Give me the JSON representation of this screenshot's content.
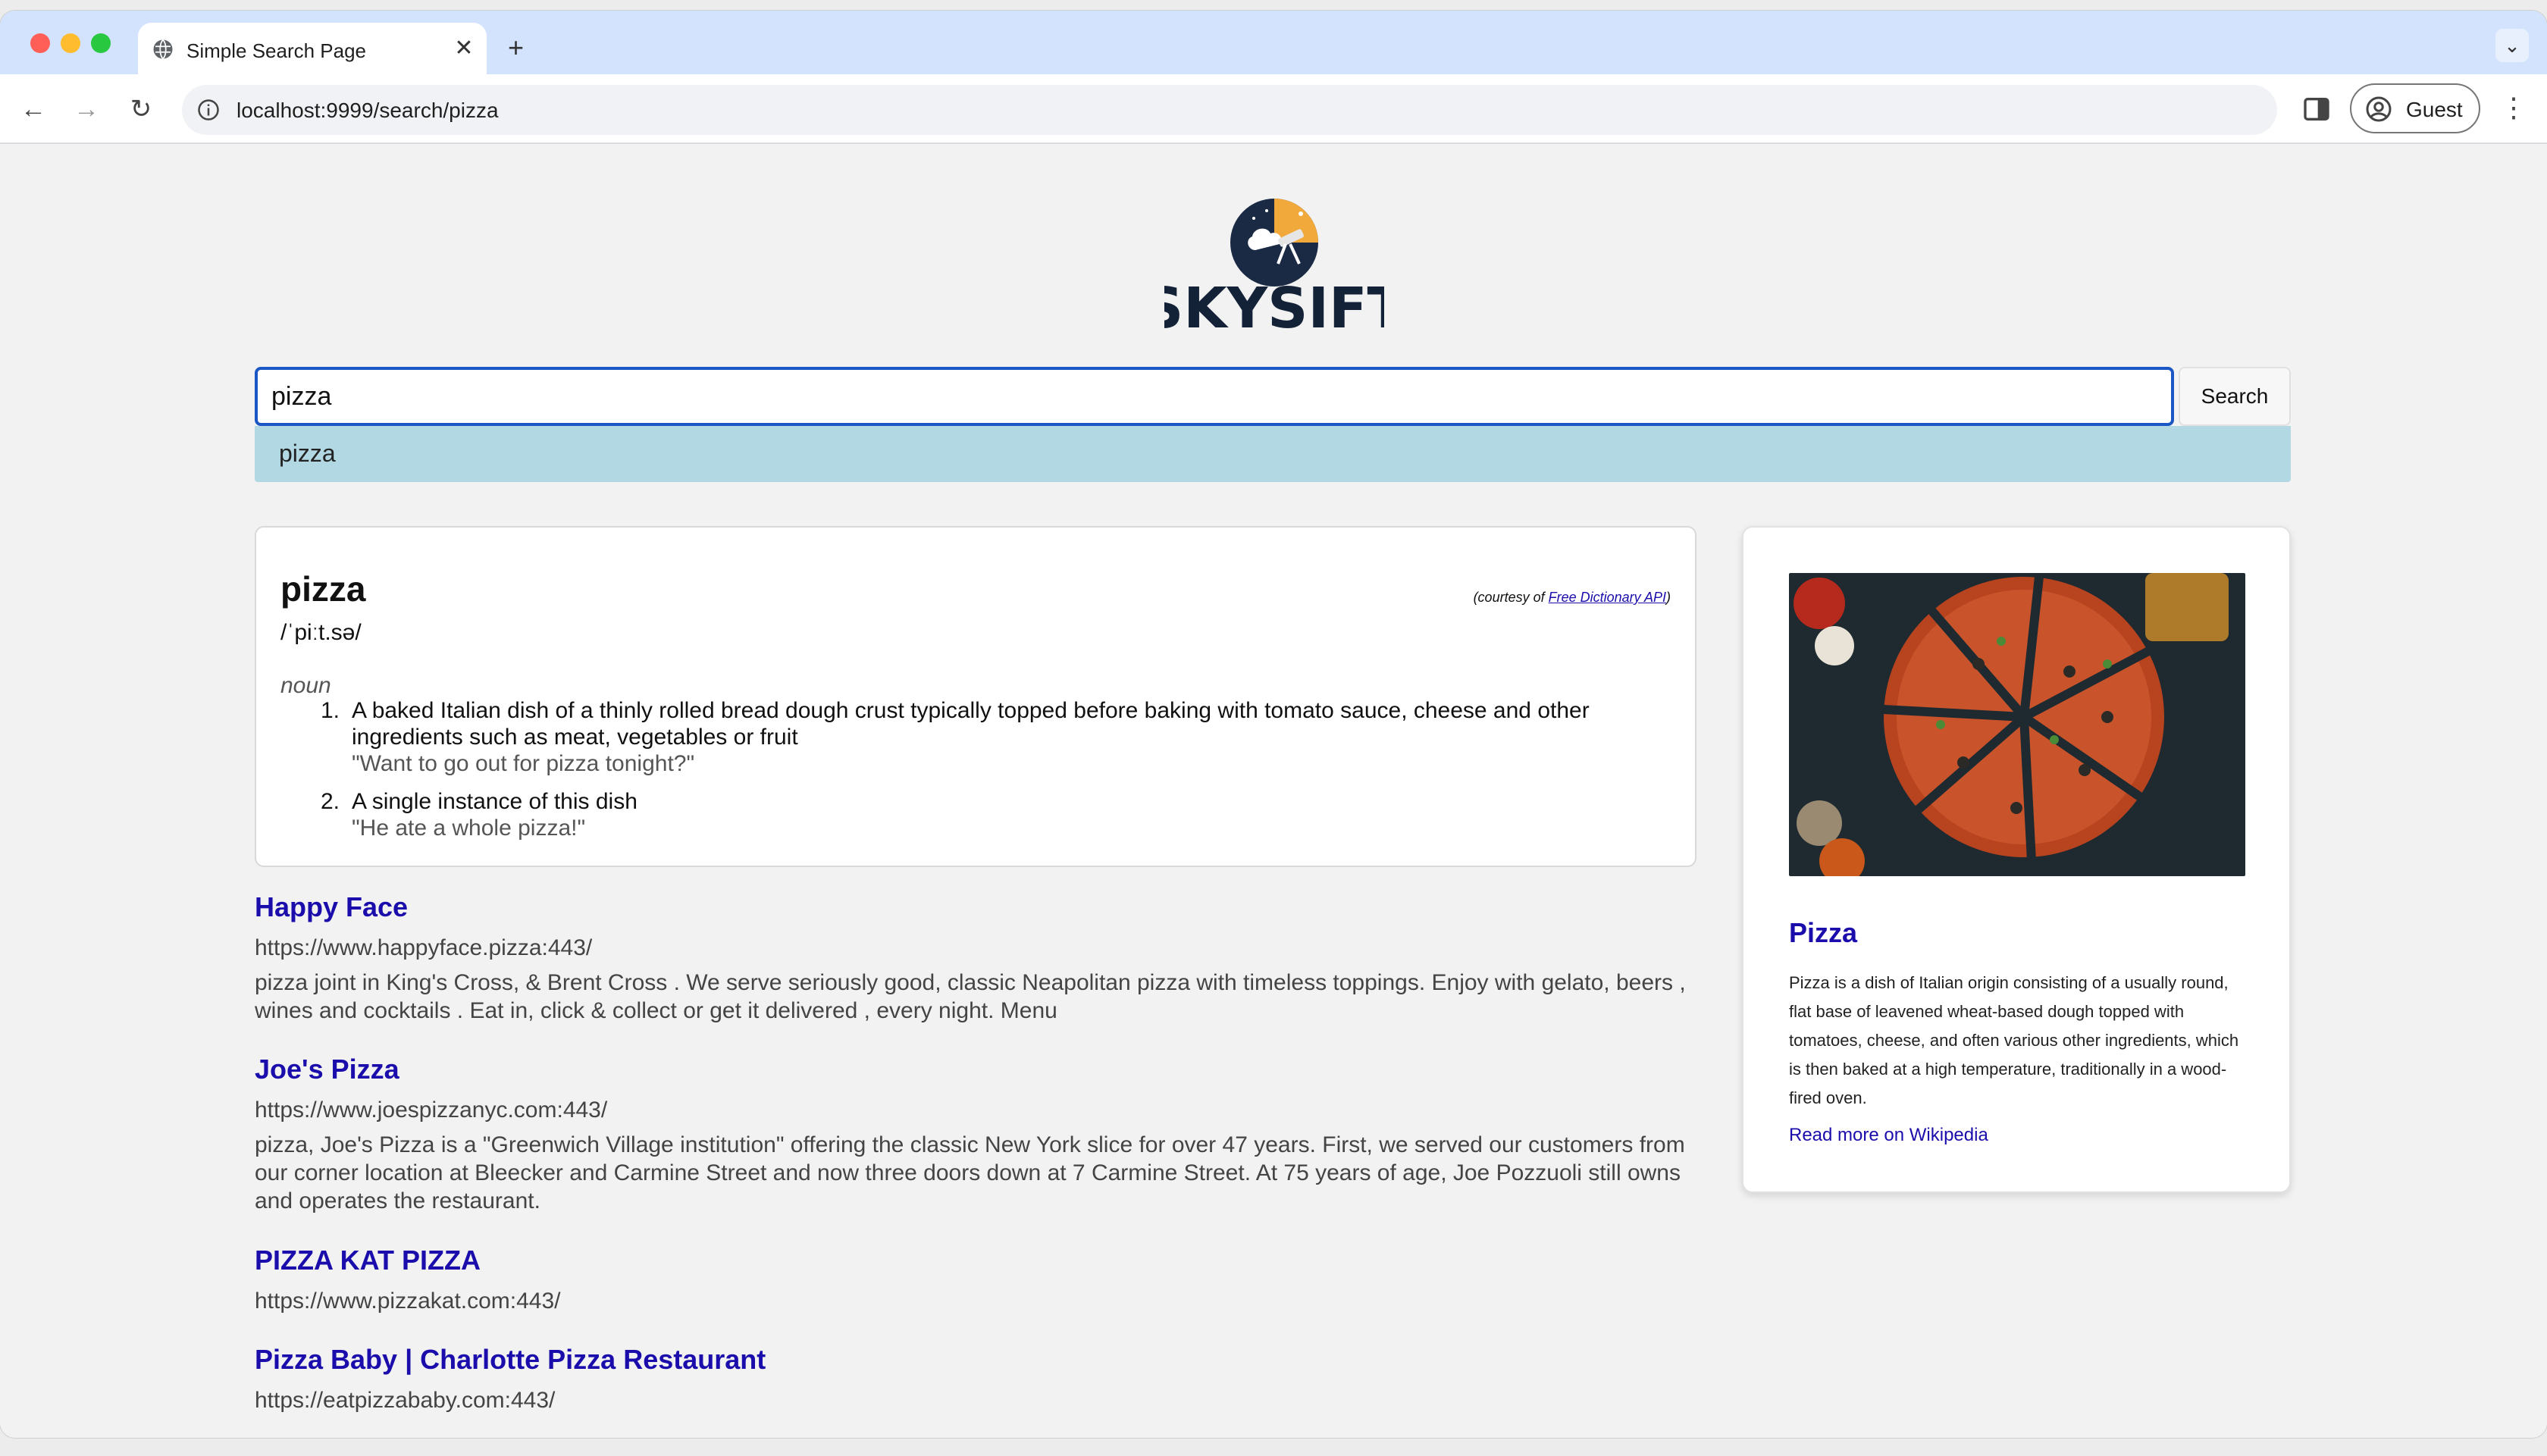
{
  "browser": {
    "tab_title": "Simple Search Page",
    "tab_close": "✕",
    "new_tab": "+",
    "tab_menu": "⌄",
    "url": "localhost:9999/search/pizza",
    "profile_label": "Guest",
    "icons": [
      "globe-icon",
      "back-icon",
      "forward-icon",
      "reload-icon",
      "info-icon",
      "side-panel-icon",
      "profile-icon",
      "kebab-menu-icon"
    ],
    "nav": {
      "back": "←",
      "forward": "→",
      "reload": "↻",
      "menu": "⋮"
    }
  },
  "logo": {
    "text": "SKYSIFT"
  },
  "search": {
    "query": "pizza",
    "button_label": "Search",
    "suggestion": "pizza"
  },
  "dictionary": {
    "word": "pizza",
    "phonetic": "/ˈpiːt.sə/",
    "courtesy_prefix": "(courtesy of ",
    "courtesy_link": "Free Dictionary API",
    "courtesy_suffix": ")",
    "part_of_speech": "noun",
    "definitions": [
      {
        "num": "1.",
        "text": "A baked Italian dish of a thinly rolled bread dough crust typically topped before baking with tomato sauce, cheese and other ingredients such as meat, vegetables or fruit",
        "example": "\"Want to go out for pizza tonight?\""
      },
      {
        "num": "2.",
        "text": "A single instance of this dish",
        "example": "\"He ate a whole pizza!\""
      }
    ]
  },
  "results": [
    {
      "title": "Happy Face",
      "url": "https://www.happyface.pizza:443/",
      "snippet": "pizza joint in King's Cross, & Brent Cross . We serve seriously good, classic Neapolitan pizza with timeless toppings. Enjoy with gelato, beers , wines and cocktails . Eat in, click & collect or get it delivered , every night. Menu"
    },
    {
      "title": "Joe's Pizza",
      "url": "https://www.joespizzanyc.com:443/",
      "snippet": "pizza, Joe's Pizza is a \"Greenwich Village institution\" offering the classic New York slice for over 47 years.  First,  we served our customers from our corner location at Bleecker and Carmine Street and now three doors down at 7 Carmine Street.  At 75 years of age, Joe Pozzuoli still owns and operates the restaurant."
    },
    {
      "title": "PIZZA KAT PIZZA",
      "url": "https://www.pizzakat.com:443/",
      "snippet": ""
    },
    {
      "title": "Pizza Baby | Charlotte Pizza Restaurant",
      "url": "https://eatpizzababy.com:443/",
      "snippet": ""
    }
  ],
  "wiki": {
    "title": "Pizza",
    "description": "Pizza is a dish of Italian origin consisting of a usually round, flat base of leavened wheat-based dough topped with tomatoes, cheese, and often various other ingredients, which is then baked at a high temperature, traditionally in a wood-fired oven.",
    "link_label": "Read more on Wikipedia"
  },
  "colors": {
    "link": "#1a0dab",
    "suggestion_bg": "#b2d8e4",
    "input_border": "#1a57c4",
    "tabbar": "#d3e3fd"
  }
}
